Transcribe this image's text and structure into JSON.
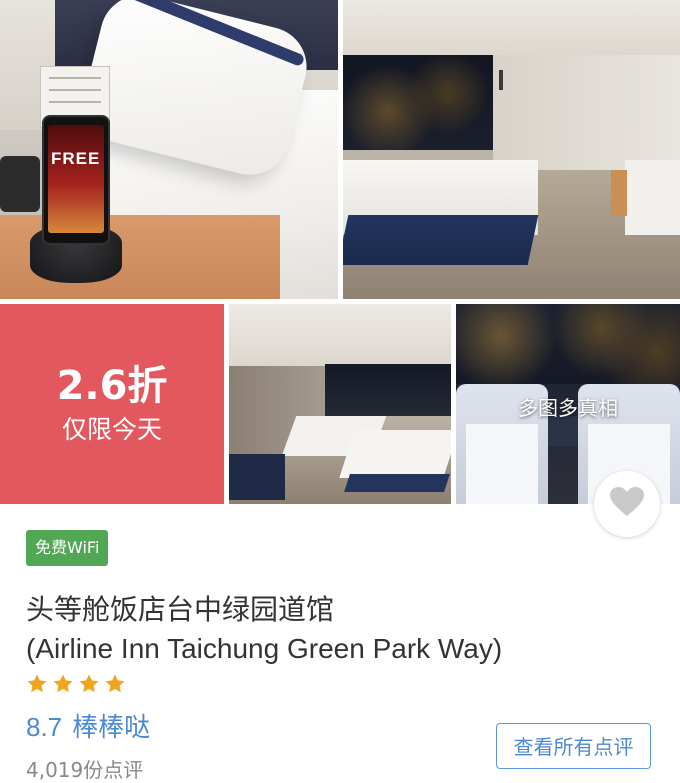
{
  "promo": {
    "discount": "2.6折",
    "until": "仅限今天"
  },
  "gallery": {
    "more_photos_label": "多图多真相"
  },
  "phone_screen_text": "FREE",
  "amenity_badge": "免费WiFi",
  "hotel": {
    "name_cn": "头等舱饭店台中绿园道馆",
    "name_en": "(Airline Inn Taichung Green Park Way)",
    "star_rating": 4,
    "score": "8.7",
    "score_word": "棒棒哒",
    "review_count": "4,019份点评"
  },
  "buttons": {
    "all_reviews": "查看所有点评"
  },
  "icons": {
    "favorite": "heart-icon",
    "star": "star-icon"
  },
  "colors": {
    "promo_bg": "#e2585e",
    "wifi_badge": "#52a754",
    "accent_blue": "#4a89d6",
    "star": "#f0a51e",
    "heart": "#c9c9c9"
  }
}
